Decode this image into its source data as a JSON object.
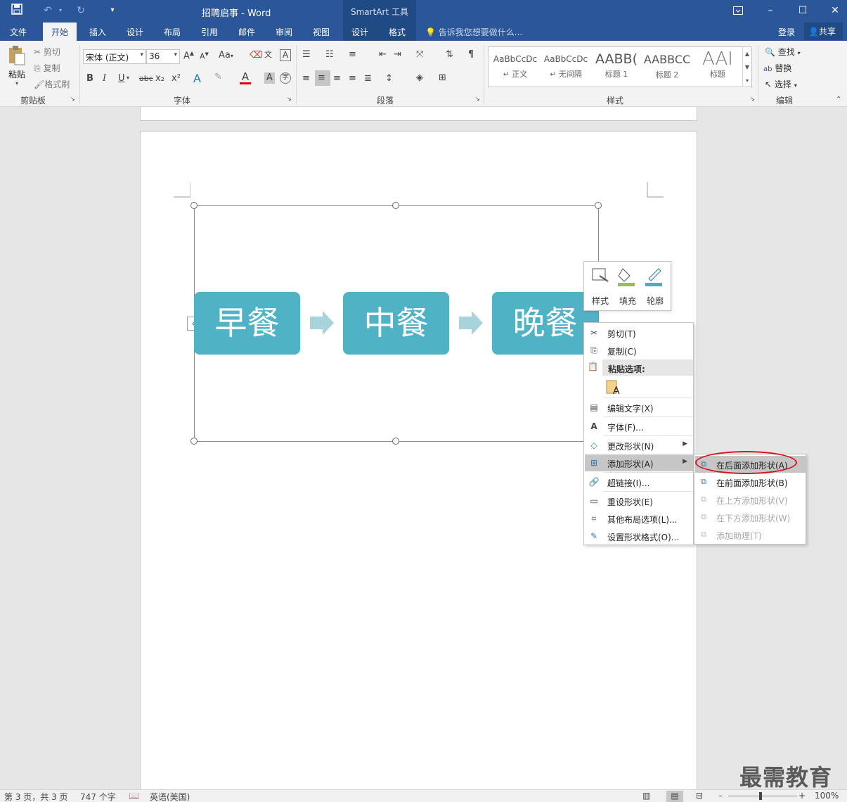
{
  "titlebar": {
    "doc_title": "招聘启事 - Word",
    "context_tools": "SmartArt 工具"
  },
  "tabs": {
    "file": "文件",
    "home": "开始",
    "insert": "插入",
    "design": "设计",
    "layout": "布局",
    "references": "引用",
    "mailings": "邮件",
    "review": "审阅",
    "view": "视图",
    "sa_design": "设计",
    "sa_format": "格式",
    "tell_me": "告诉我您想要做什么...",
    "login": "登录",
    "share": "共享"
  },
  "ribbon": {
    "clipboard": {
      "paste": "粘贴",
      "cut": "剪切",
      "copy": "复制",
      "format_painter": "格式刷",
      "label": "剪贴板"
    },
    "font": {
      "name": "宋体 (正文)",
      "size": "36",
      "label": "字体",
      "aa": "Aa",
      "bold": "B",
      "italic": "I",
      "underline": "U",
      "strike": "abc",
      "sub": "x₂",
      "sup": "x²",
      "color_a": "A"
    },
    "paragraph": {
      "label": "段落"
    },
    "styles": {
      "label": "样式",
      "tiles": [
        {
          "preview": "AaBbCcDc",
          "name": "↵ 正文"
        },
        {
          "preview": "AaBbCcDc",
          "name": "↵ 无间隔"
        },
        {
          "preview": "AABB(",
          "name": "标题 1"
        },
        {
          "preview": "AABBCC",
          "name": "标题 2"
        },
        {
          "preview": "AAI",
          "name": "标题"
        }
      ]
    },
    "editing": {
      "find": "查找",
      "replace": "替换",
      "select": "选择",
      "label": "编辑"
    }
  },
  "smartart": {
    "shapes": [
      "早餐",
      "中餐",
      "晚餐"
    ],
    "fill_color": "#4fb2c5",
    "arrow_color": "#a9d3dc"
  },
  "mini_toolbar": {
    "style": "样式",
    "fill": "填充",
    "outline": "轮廓"
  },
  "context_menu": {
    "cut": "剪切(T)",
    "copy": "复制(C)",
    "paste_options": "粘贴选项:",
    "edit_text": "编辑文字(X)",
    "font": "字体(F)...",
    "change_shape": "更改形状(N)",
    "add_shape": "添加形状(A)",
    "hyperlink": "超链接(I)...",
    "reset_shape": "重设形状(E)",
    "more_layout": "其他布局选项(L)...",
    "format_shape": "设置形状格式(O)..."
  },
  "submenu": {
    "add_after": "在后面添加形状(A)",
    "add_before": "在前面添加形状(B)",
    "add_above": "在上方添加形状(V)",
    "add_below": "在下方添加形状(W)",
    "add_assistant": "添加助理(T)"
  },
  "status": {
    "page": "第 3 页，共 3 页",
    "words": "747 个字",
    "lang": "英语(美国)",
    "zoom": "100%"
  },
  "watermark": "最需教育"
}
